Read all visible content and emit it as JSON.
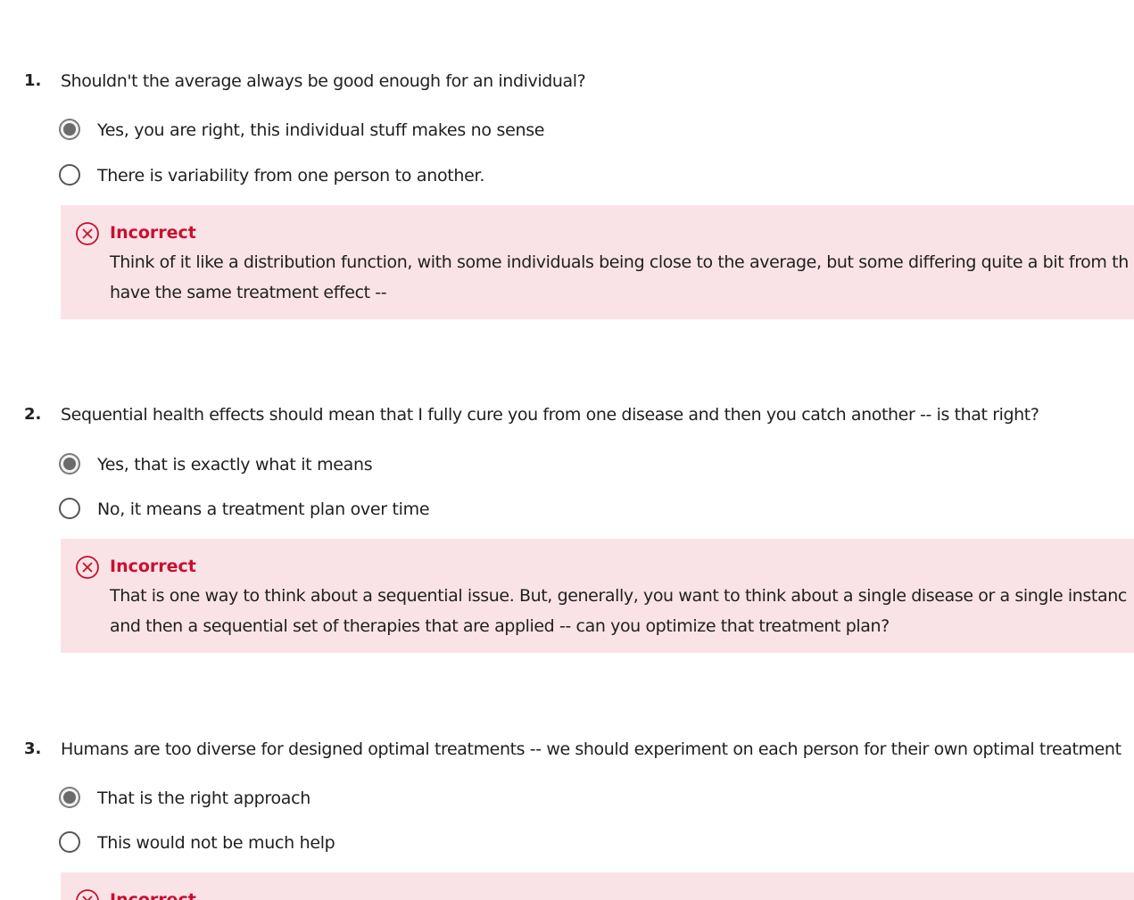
{
  "colors": {
    "incorrect_text": "#c8102e",
    "feedback_background": "#fae3e6",
    "radio_selected": "#6b6b6b"
  },
  "questions": [
    {
      "number": "1.",
      "text": "Shouldn't the average always be good enough for an individual?",
      "options": [
        {
          "label": "Yes, you are right, this individual stuff makes no sense",
          "selected": true
        },
        {
          "label": "There is variability from one person to another.",
          "selected": false
        }
      ],
      "feedback": {
        "icon": "x-circle-icon",
        "status": "Incorrect",
        "lines": [
          "Think of it like a distribution function, with some individuals being close to the average, but some differing quite a bit from th",
          "have the same treatment effect --"
        ]
      }
    },
    {
      "number": "2.",
      "text": "Sequential health effects should mean that I fully cure you from one disease and then you catch another -- is that right?",
      "options": [
        {
          "label": "Yes, that is exactly what it means",
          "selected": true
        },
        {
          "label": "No, it means a treatment plan over time",
          "selected": false
        }
      ],
      "feedback": {
        "icon": "x-circle-icon",
        "status": "Incorrect",
        "lines": [
          "That is one way to think about a sequential issue.  But, generally, you want to think about a single disease or a single instanc",
          "and then a sequential set of therapies that are applied -- can you optimize that treatment plan?"
        ]
      }
    },
    {
      "number": "3.",
      "text": "Humans are too diverse for designed optimal treatments -- we should experiment on each person for their own optimal treatment",
      "options": [
        {
          "label": "That is the right approach",
          "selected": true
        },
        {
          "label": "This would not be much help",
          "selected": false
        }
      ],
      "feedback": {
        "icon": "x-circle-icon",
        "status": "Incorrect",
        "lines": []
      }
    }
  ]
}
